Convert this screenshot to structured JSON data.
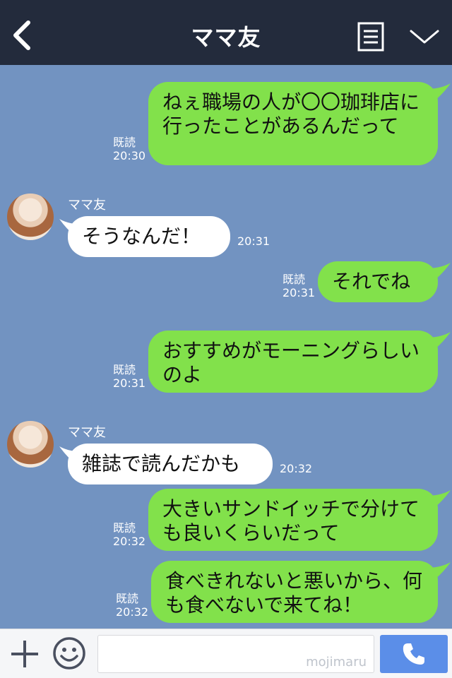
{
  "header": {
    "title": "ママ友",
    "back_icon": "chevron-left-icon",
    "menu_icon": "menu-icon",
    "collapse_icon": "chevron-down-icon"
  },
  "messages": [
    {
      "text": "ねぇ職場の人が〇〇珈琲店に行ったことがあるんだって",
      "read": "既読",
      "time": "20:30"
    },
    {
      "sender": "ママ友",
      "text": "そうなんだ！",
      "time": "20:31"
    },
    {
      "text": "それでね",
      "read": "既読",
      "time": "20:31"
    },
    {
      "text": "おすすめがモーニングらしいのよ",
      "read": "既読",
      "time": "20:31"
    },
    {
      "sender": "ママ友",
      "text": "雑誌で読んだかも",
      "time": "20:32"
    },
    {
      "text": "大きいサンドイッチで分けても良いくらいだって",
      "read": "既読",
      "time": "20:32"
    },
    {
      "text": "食べきれないと悪いから、何も食べないで来てね！",
      "read": "既読",
      "time": "20:32"
    }
  ],
  "footer": {
    "plus_icon": "plus-icon",
    "emoji_icon": "smiley-icon",
    "input_value": "",
    "watermark": "mojimaru",
    "call_icon": "phone-icon"
  },
  "colors": {
    "header_bg": "#232b3c",
    "chat_bg": "#7293c1",
    "outgoing_bubble": "#82e14b",
    "incoming_bubble": "#ffffff",
    "call_button": "#5b8ee8"
  }
}
